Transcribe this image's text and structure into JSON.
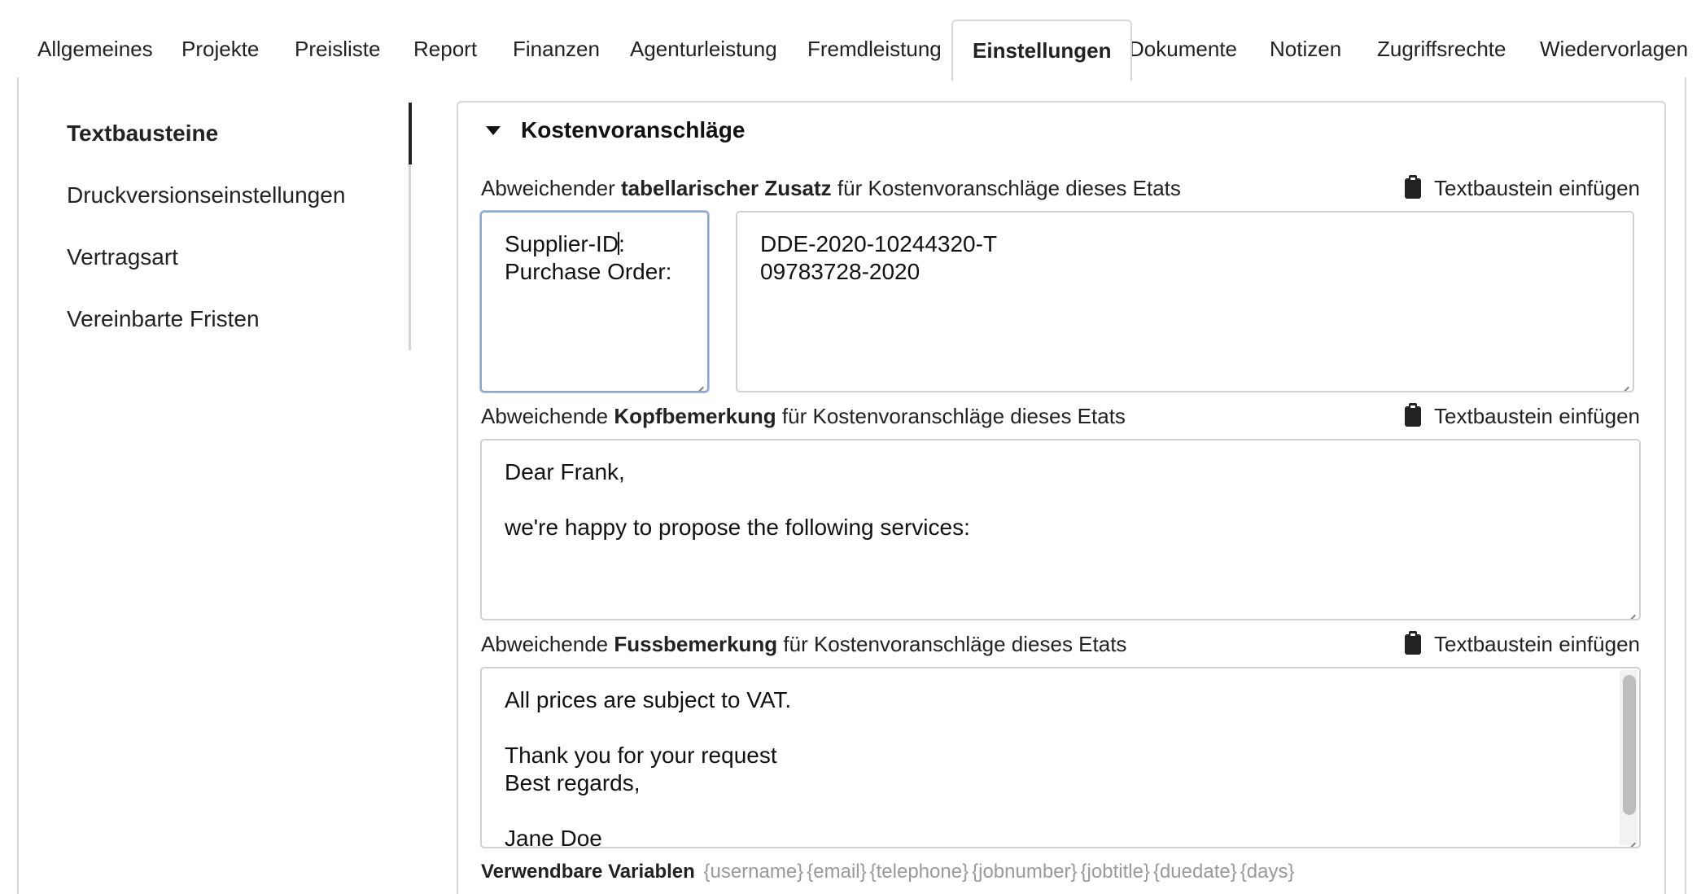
{
  "tabs": [
    {
      "label": "Allgemeines",
      "active": false
    },
    {
      "label": "Projekte",
      "active": false
    },
    {
      "label": "Preisliste",
      "active": false
    },
    {
      "label": "Report",
      "active": false
    },
    {
      "label": "Finanzen",
      "active": false
    },
    {
      "label": "Agenturleistung",
      "active": false
    },
    {
      "label": "Fremdleistung",
      "active": false
    },
    {
      "label": "Einstellungen",
      "active": true
    },
    {
      "label": "Dokumente",
      "active": false
    },
    {
      "label": "Notizen",
      "active": false
    },
    {
      "label": "Zugriffsrechte",
      "active": false
    },
    {
      "label": "Wiedervorlagen",
      "active": false
    }
  ],
  "sidebar": {
    "items": [
      {
        "label": "Textbausteine",
        "active": true
      },
      {
        "label": "Druckversionseinstellungen",
        "active": false
      },
      {
        "label": "Vertragsart",
        "active": false
      },
      {
        "label": "Vereinbarte Fristen",
        "active": false
      }
    ]
  },
  "section": {
    "title": "Kostenvoranschläge",
    "insert_label": "Textbaustein einfügen",
    "fields": {
      "tabular": {
        "label_pre": "Abweichender ",
        "label_bold": "tabellarischer Zusatz",
        "label_post": " für Kostenvoranschläge dieses Etats",
        "keys_line1_before_cursor": "Supplier-ID",
        "keys_line1_after_cursor": ":",
        "keys_line2": "Purchase Order:",
        "values": "DDE-2020-10244320-T\n09783728-2020"
      },
      "header": {
        "label_pre": "Abweichende ",
        "label_bold": "Kopfbemerkung",
        "label_post": " für Kostenvoranschläge dieses Etats",
        "value": "Dear Frank,\n\nwe're happy to propose the following services:"
      },
      "footer": {
        "label_pre": "Abweichende ",
        "label_bold": "Fussbemerkung",
        "label_post": " für Kostenvoranschläge dieses Etats",
        "value": "All prices are subject to VAT.\n\nThank you for your request\nBest regards,\n\nJane Doe"
      }
    },
    "variables": {
      "label": "Verwendbare Variablen",
      "tokens": [
        "{username}",
        "{email}",
        "{telephone}",
        "{jobnumber}",
        "{jobtitle}",
        "{duedate}",
        "{days}"
      ]
    }
  }
}
